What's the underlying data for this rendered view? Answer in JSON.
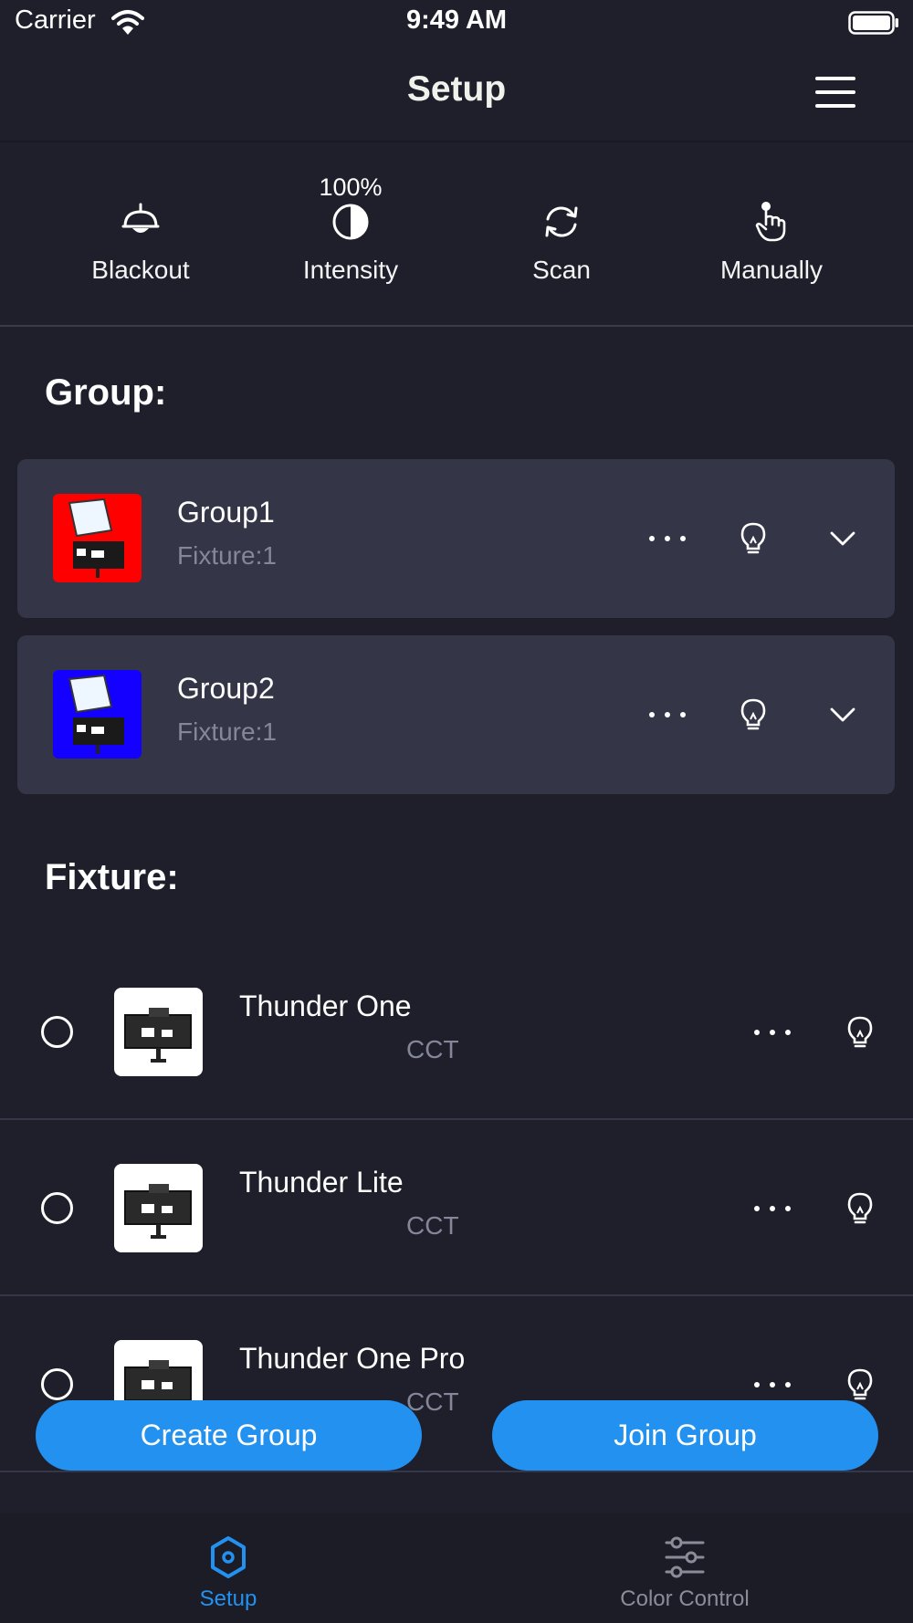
{
  "status_bar": {
    "carrier": "Carrier",
    "time": "9:49 AM"
  },
  "nav": {
    "title": "Setup"
  },
  "toolbar": {
    "intensity_value": "100%",
    "items": [
      {
        "label": "Blackout",
        "icon": "lamp-icon"
      },
      {
        "label": "Intensity",
        "icon": "half-circle-icon"
      },
      {
        "label": "Scan",
        "icon": "refresh-icon"
      },
      {
        "label": "Manually",
        "icon": "hand-pointer-icon"
      }
    ]
  },
  "groups_section": {
    "title": "Group:",
    "groups": [
      {
        "name": "Group1",
        "fixture_count": "Fixture:1",
        "color": "#ff0000"
      },
      {
        "name": "Group2",
        "fixture_count": "Fixture:1",
        "color": "#1400ff"
      }
    ]
  },
  "fixtures_section": {
    "title": "Fixture:",
    "fixtures": [
      {
        "name": "Thunder One",
        "mode": "CCT"
      },
      {
        "name": "Thunder Lite",
        "mode": "CCT"
      },
      {
        "name": "Thunder One Pro",
        "mode": "CCT"
      }
    ]
  },
  "actions": {
    "create_group": "Create Group",
    "join_group": "Join Group"
  },
  "tab_bar": {
    "tabs": [
      {
        "label": "Setup",
        "active": true,
        "icon": "hexagon-icon"
      },
      {
        "label": "Color Control",
        "active": false,
        "icon": "sliders-icon"
      }
    ]
  },
  "colors": {
    "accent": "#2391f0",
    "background": "#1e1f2b",
    "card": "#343648",
    "muted_text": "#84869a"
  }
}
